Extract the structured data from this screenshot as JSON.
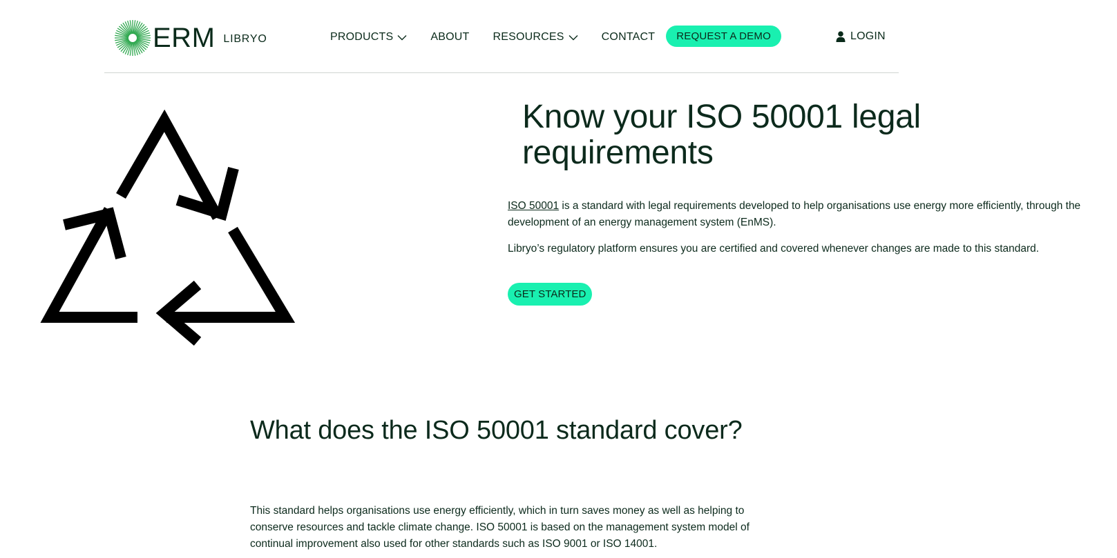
{
  "header": {
    "logo_text": "ERM",
    "logo_sub": "LIBRYO",
    "nav": {
      "products": "PRODUCTS",
      "about": "ABOUT",
      "resources": "RESOURCES",
      "contact": "CONTACT"
    },
    "demo_button": "REQUEST A DEMO",
    "login": "LOGIN"
  },
  "hero": {
    "title": "Know your ISO 50001 legal requirements",
    "link_text": "ISO 50001",
    "para1_rest": " is a standard with legal requirements developed to help organisations use energy more efficiently, through the development of an energy management system (EnMS).",
    "para2": "Libryo’s regulatory platform ensures you are certified and covered whenever changes are made to this standard.",
    "cta": "GET STARTED",
    "graphic_icon": "recycle-arrows-icon"
  },
  "section": {
    "title": "What does the ISO 50001 standard cover?",
    "body": "This standard helps organisations use energy efficiently, which in turn saves money as well as helping to conserve resources and tackle climate change. ISO 50001 is based on the management system model of continual improvement also used for other standards such as ISO 9001 or ISO 14001."
  },
  "colors": {
    "accent": "#19f0b0",
    "text": "#0c2a1c",
    "logo_green": "#2fa84f",
    "divider": "#cfd4d1"
  }
}
